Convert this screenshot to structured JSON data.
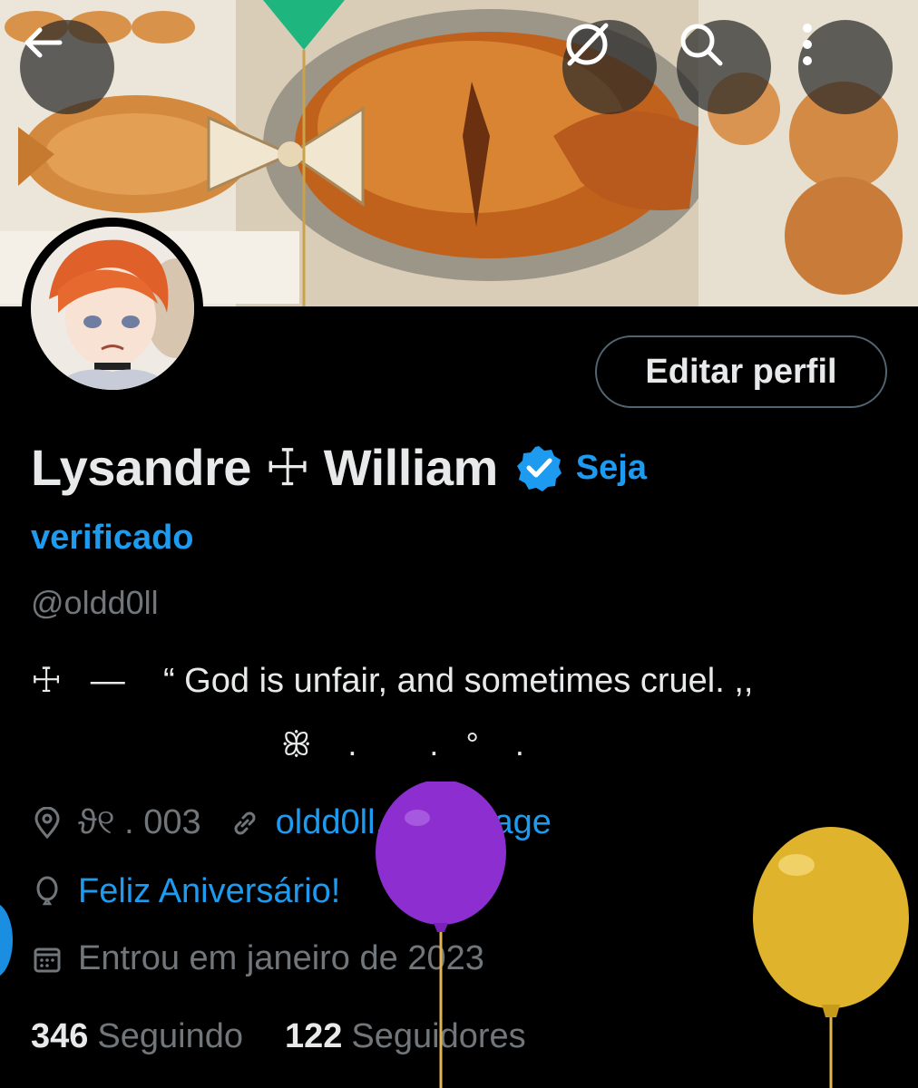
{
  "toolbar": {
    "back_icon": "arrow-left-icon",
    "grok_icon": "grok-icon",
    "search_icon": "search-icon",
    "more_icon": "more-vertical-icon"
  },
  "profile": {
    "display_name": "Lysandre ☩ William",
    "get_verified_line1": "Seja",
    "get_verified_line2": "verificado",
    "handle": "@oldd0ll",
    "edit_button": "Editar perfil",
    "bio_line1": "☩   —    “ God is unfair, and sometimes cruel. ,,",
    "bio_line2": "ꕥ    .        .   °    .",
    "location": "ϑ୧ . 003",
    "website": "oldd0ll.straw.page",
    "birthday": "Feliz Aniversário!",
    "joined": "Entrou em janeiro de 2023",
    "following_count": "346",
    "following_label": "Seguindo",
    "followers_count": "122",
    "followers_label": "Seguidores"
  },
  "colors": {
    "accent": "#1d9bf0",
    "muted": "#71767b",
    "text": "#e7e9ea",
    "background": "#000000"
  }
}
